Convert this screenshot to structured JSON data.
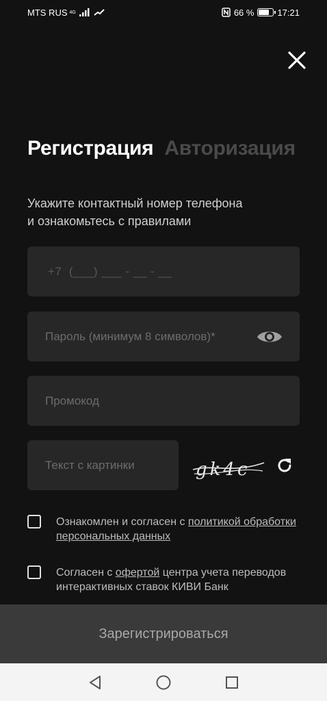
{
  "status_bar": {
    "carrier": "MTS RUS",
    "network": "4G",
    "battery": "66 %",
    "time": "17:21"
  },
  "tabs": {
    "registration": "Регистрация",
    "authorization": "Авторизация"
  },
  "subtitle": {
    "line1": "Укажите контактный номер телефона",
    "line2": "и ознакомьтесь с правилами"
  },
  "fields": {
    "phone_placeholder": "+7  (___) ___ - __ - __",
    "password_placeholder": "Пароль (минимум 8 символов)*",
    "promo_placeholder": "Промокод",
    "captcha_placeholder": "Текст с картинки"
  },
  "captcha": {
    "text": "gk4c"
  },
  "agreements": {
    "privacy_prefix": "Ознакомлен и согласен с ",
    "privacy_link": "политикой обработки персональных данных",
    "offer_prefix": "Согласен с ",
    "offer_link": "офертой",
    "offer_suffix": " центра учета переводов интерактивных ставок КИВИ Банк"
  },
  "buttons": {
    "register": "Зарегистрироваться"
  },
  "colors": {
    "background": "#121212",
    "field": "#272727",
    "button": "#3a3a3a",
    "inactive_tab": "#4a4a4a"
  }
}
